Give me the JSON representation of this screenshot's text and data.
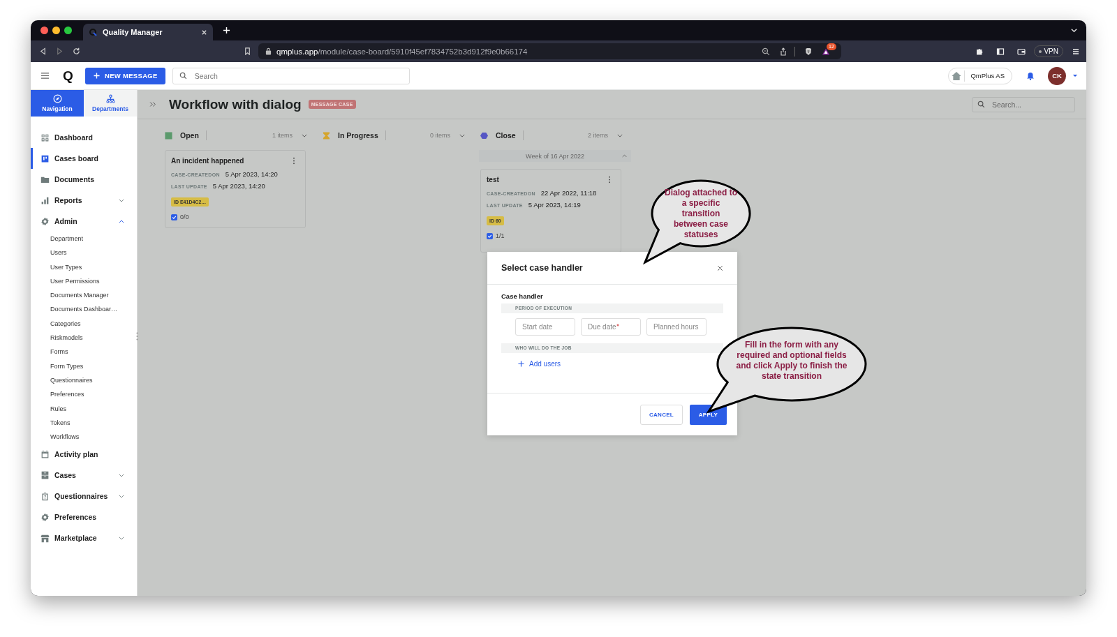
{
  "browser": {
    "tab_title": "Quality Manager",
    "url_host": "qmplus.app",
    "url_path": "/module/case-board/5910f45ef7834752b3d912f9e0b66174",
    "extension_badge": "12",
    "vpn_label": "VPN"
  },
  "header": {
    "logo_letter": "Q",
    "new_message_label": "NEW MESSAGE",
    "search_placeholder": "Search",
    "organization": "QmPlus AS",
    "user_initials": "CK"
  },
  "sidebar": {
    "tabs": [
      {
        "label": "Navigation",
        "selected": true
      },
      {
        "label": "Departments",
        "selected": false
      }
    ],
    "items": [
      {
        "label": "Dashboard",
        "selected": false
      },
      {
        "label": "Cases board",
        "selected": true
      },
      {
        "label": "Documents",
        "selected": false
      },
      {
        "label": "Reports",
        "selected": false,
        "expanded": false
      },
      {
        "label": "Admin",
        "selected": false,
        "expanded": true,
        "children": [
          {
            "label": "Department",
            "selected": false
          },
          {
            "label": "Users",
            "selected": false
          },
          {
            "label": "User Types",
            "selected": false
          },
          {
            "label": "User Permissions",
            "selected": false
          },
          {
            "label": "Documents Manager",
            "selected": false
          },
          {
            "label": "Documents Dashboar…",
            "selected": false
          },
          {
            "label": "Categories",
            "selected": false
          },
          {
            "label": "Riskmodels",
            "selected": false
          },
          {
            "label": "Forms",
            "selected": false
          },
          {
            "label": "Form Types",
            "selected": false
          },
          {
            "label": "Questionnaires",
            "selected": false
          },
          {
            "label": "Preferences",
            "selected": false
          },
          {
            "label": "Rules",
            "selected": false
          },
          {
            "label": "Tokens",
            "selected": false
          },
          {
            "label": "Workflows",
            "selected": false
          }
        ]
      },
      {
        "label": "Activity plan",
        "selected": false
      },
      {
        "label": "Cases",
        "selected": false,
        "expanded": false
      },
      {
        "label": "Questionnaires",
        "selected": false,
        "expanded": false
      },
      {
        "label": "Preferences",
        "selected": false
      },
      {
        "label": "Marketplace",
        "selected": false,
        "expanded": false
      }
    ]
  },
  "page": {
    "title": "Workflow with dialog",
    "badge": "MESSAGE CASE",
    "search_placeholder": "Search..."
  },
  "columns": [
    {
      "name": "Open",
      "kind": "square",
      "color": "#5b9a6c",
      "count": "1 items",
      "cards": [
        {
          "title": "An incident happened",
          "fields": [
            {
              "label": "CASE-CREATEDON",
              "value": "5 Apr 2023, 14:20"
            },
            {
              "label": "LAST UPDATE",
              "value": "5 Apr 2023, 14:20"
            }
          ],
          "id": "ID E41D4C2…",
          "checked": true,
          "progress": "0/0"
        }
      ]
    },
    {
      "name": "In Progress",
      "kind": "hourglass",
      "color": "#d5a52d",
      "count": "0 items"
    },
    {
      "name": "Close",
      "kind": "hexagon",
      "color": "#5656c4",
      "count": "2 items",
      "group": {
        "label": "Week of 16 Apr 2022",
        "expanded": true
      },
      "cards": [
        {
          "title": "test",
          "fields": [
            {
              "label": "CASE-CREATEDON",
              "value": "22 Apr 2022, 11:18"
            },
            {
              "label": "LAST UPDATE",
              "value": "5 Apr 2023, 14:19"
            }
          ],
          "id": "ID 60",
          "checked": true,
          "progress": "1/1"
        }
      ]
    }
  ],
  "dialog": {
    "title": "Select case handler",
    "section": "Case handler",
    "period_label": "PERIOD OF EXECUTION",
    "fields": [
      {
        "placeholder": "Start date",
        "required": false
      },
      {
        "placeholder": "Due date",
        "required": true
      },
      {
        "placeholder": "Planned hours",
        "required": false
      }
    ],
    "who_label": "WHO WILL DO THE JOB",
    "add_users": "Add users",
    "cancel": "CANCEL",
    "apply": "APPLY"
  },
  "callouts": [
    {
      "text": "Dialog attached to a specific transition between case statuses"
    },
    {
      "text": "Fill in the form with any required and optional fields and click Apply to finish the state transition"
    }
  ]
}
